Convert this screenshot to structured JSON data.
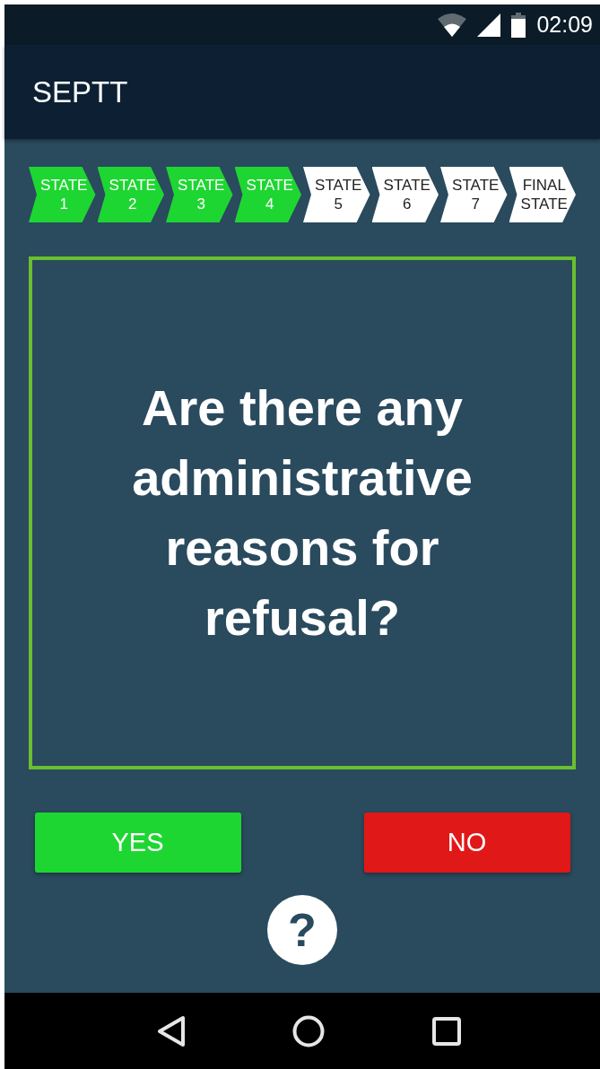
{
  "status_bar": {
    "time": "02:09"
  },
  "app_bar": {
    "title": "SEPTT"
  },
  "steps": [
    {
      "lines": [
        "STATE",
        "1"
      ],
      "completed": true
    },
    {
      "lines": [
        "STATE",
        "2"
      ],
      "completed": true
    },
    {
      "lines": [
        "STATE",
        "3"
      ],
      "completed": true
    },
    {
      "lines": [
        "STATE",
        "4"
      ],
      "completed": true
    },
    {
      "lines": [
        "STATE",
        "5"
      ],
      "completed": false
    },
    {
      "lines": [
        "STATE",
        "6"
      ],
      "completed": false
    },
    {
      "lines": [
        "STATE",
        "7"
      ],
      "completed": false
    },
    {
      "lines": [
        "FINAL",
        "STATE"
      ],
      "completed": false
    }
  ],
  "question": "Are there any administrative reasons for refusal?",
  "answers": [
    {
      "label": "YES",
      "kind": "yes"
    },
    {
      "label": "NO",
      "kind": "no"
    }
  ],
  "help_button": {
    "label": "?"
  }
}
